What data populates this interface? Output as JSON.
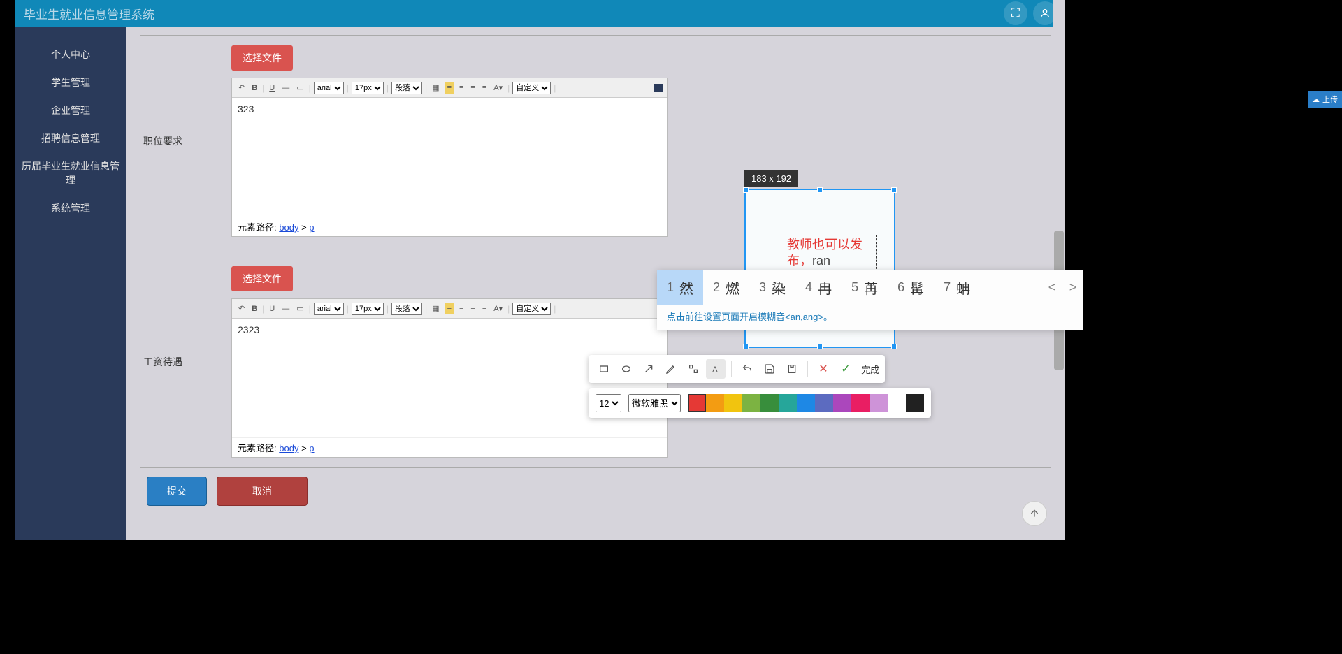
{
  "header": {
    "title": "毕业生就业信息管理系统"
  },
  "sidebar": {
    "items": [
      {
        "label": "个人中心"
      },
      {
        "label": "学生管理"
      },
      {
        "label": "企业管理"
      },
      {
        "label": "招聘信息管理"
      },
      {
        "label": "历届毕业生就业信息管理"
      },
      {
        "label": "系统管理"
      }
    ]
  },
  "forms": {
    "file_button": "选择文件",
    "section1": {
      "label": "职位要求",
      "content": "323",
      "path_label": "元素路径:",
      "path_body": "body",
      "path_p": "p"
    },
    "section2": {
      "label": "工资待遇",
      "content": "2323",
      "path_label": "元素路径:",
      "path_body": "body",
      "path_p": "p"
    },
    "toolbar": {
      "font": "arial",
      "size": "17px",
      "para": "段落",
      "custom": "自定义"
    },
    "actions": {
      "submit": "提交",
      "cancel": "取消"
    }
  },
  "annotation": {
    "size_label": "183 x 192",
    "text_line1": "教师也可以发",
    "text_line2_prefix": "布，",
    "pinyin": "ran"
  },
  "ime": {
    "candidates": [
      {
        "num": "1",
        "char": "然"
      },
      {
        "num": "2",
        "char": "燃"
      },
      {
        "num": "3",
        "char": "染"
      },
      {
        "num": "4",
        "char": "冉"
      },
      {
        "num": "5",
        "char": "苒"
      },
      {
        "num": "6",
        "char": "髯"
      },
      {
        "num": "7",
        "char": "蚺"
      }
    ],
    "hint": "点击前往设置页面开启模糊音<an,ang>。"
  },
  "screenshot": {
    "done_label": "完成",
    "font_size": "12",
    "font_family": "微软雅黑",
    "colors": [
      "#e53935",
      "#f39c12",
      "#f1c40f",
      "#7cb342",
      "#388e3c",
      "#26a69a",
      "#1e88e5",
      "#5c6bc0",
      "#ab47bc",
      "#e91e63",
      "#ce93d8",
      "#ffffff",
      "#212121"
    ]
  },
  "upload_badge": {
    "label": "上传"
  }
}
